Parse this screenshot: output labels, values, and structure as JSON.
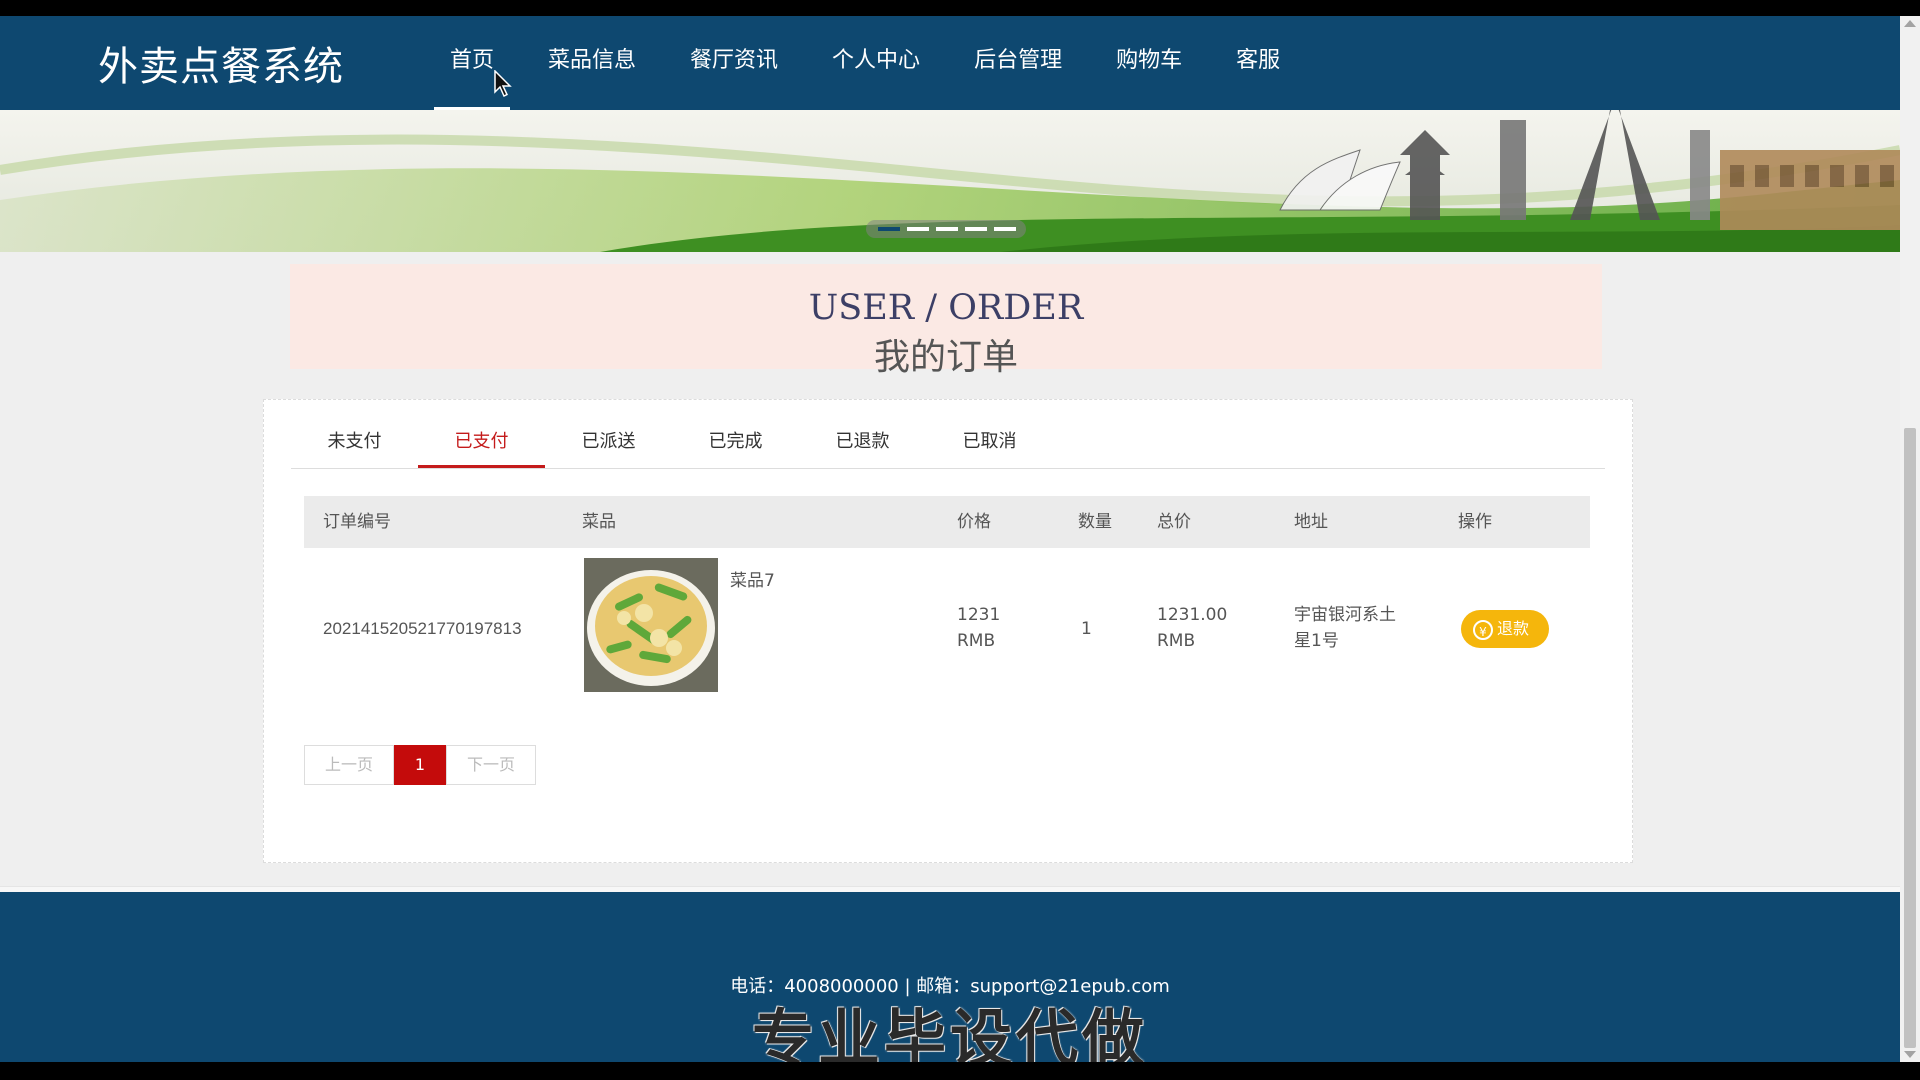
{
  "header": {
    "logo": "外卖点餐系统",
    "nav": [
      "首页",
      "菜品信息",
      "餐厅资讯",
      "个人中心",
      "后台管理",
      "购物车",
      "客服"
    ]
  },
  "banner": {
    "slide_count": 5,
    "active_slide": 1
  },
  "title": {
    "en": "USER / ORDER",
    "cn": "我的订单"
  },
  "tabs": {
    "items": [
      "未支付",
      "已支付",
      "已派送",
      "已完成",
      "已退款",
      "已取消"
    ],
    "active": "已支付"
  },
  "table": {
    "headers": [
      "订单编号",
      "菜品",
      "价格",
      "数量",
      "总价",
      "地址",
      "操作"
    ],
    "rows": [
      {
        "order_no": "20214152052177019781​3",
        "dish_name": "菜品7",
        "price_value": "1231",
        "price_unit": "RMB",
        "quantity": "1",
        "total_value": "1231.00",
        "total_unit": "RMB",
        "address_line1": "宇宙银河系土",
        "address_line2": "星1号",
        "action": "退款"
      }
    ]
  },
  "pager": {
    "prev": "上一页",
    "current": "1",
    "next": "下一页"
  },
  "footer": {
    "contact": "电话：4008000000 | 邮箱：support@21epub.com",
    "watermark": "专业毕设代做"
  },
  "colors": {
    "primary": "#0e4870",
    "active_tab": "#c41b1b",
    "refund": "#f5b60c",
    "current_page": "#c40b0b"
  }
}
